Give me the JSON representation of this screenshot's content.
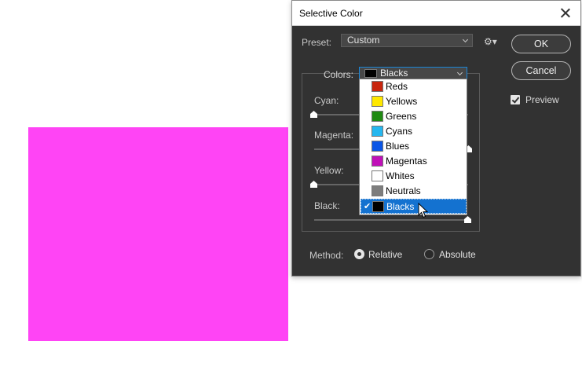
{
  "canvas": {
    "swatch_color": "#ff44f5"
  },
  "dialog": {
    "title": "Selective Color",
    "preset_label": "Preset:",
    "preset_value": "Custom",
    "ok_label": "OK",
    "cancel_label": "Cancel",
    "preview_label": "Preview",
    "preview_checked": true,
    "colors_label": "Colors:",
    "colors_value": "Blacks",
    "colors_value_swatch": "#000000",
    "sliders": [
      {
        "label": "Cyan:"
      },
      {
        "label": "Magenta:"
      },
      {
        "label": "Yellow:"
      },
      {
        "label": "Black:"
      }
    ],
    "method_label": "Method:",
    "method_options": [
      "Relative",
      "Absolute"
    ],
    "method_selected": "Relative",
    "dropdown_items": [
      {
        "label": "Reds",
        "color": "#c8260f"
      },
      {
        "label": "Yellows",
        "color": "#ffe800"
      },
      {
        "label": "Greens",
        "color": "#1f8a12"
      },
      {
        "label": "Cyans",
        "color": "#26b7ef"
      },
      {
        "label": "Blues",
        "color": "#0a55e6"
      },
      {
        "label": "Magentas",
        "color": "#c010b8"
      },
      {
        "label": "Whites",
        "color": "#ffffff"
      },
      {
        "label": "Neutrals",
        "color": "#7d7d7d"
      },
      {
        "label": "Blacks",
        "color": "#000000",
        "selected": true
      }
    ],
    "icons": [
      "close-icon",
      "chevron-down-icon",
      "gear-icon",
      "checkmark-icon",
      "mouse-pointer-icon"
    ]
  }
}
